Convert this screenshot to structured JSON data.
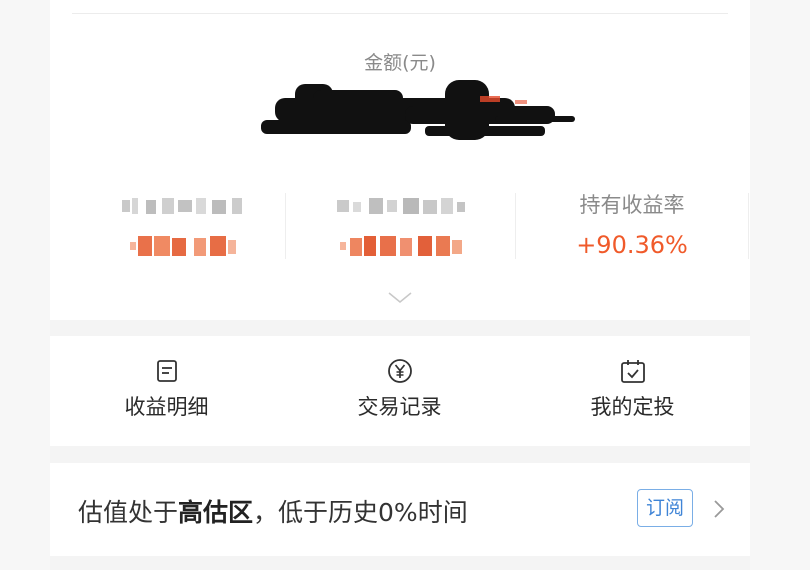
{
  "summary": {
    "amount_label": "金额(元)",
    "amount_value_redacted": true,
    "stats": [
      {
        "label_pixelated": true,
        "value_pixelated": true
      },
      {
        "label_pixelated": true,
        "value_pixelated": true
      },
      {
        "label": "持有收益率",
        "value": "+90.36%"
      }
    ],
    "expand_icon": "chevron-down-icon"
  },
  "actions": [
    {
      "label": "收益明细",
      "icon": "document-lines-icon"
    },
    {
      "label": "交易记录",
      "icon": "yen-circle-icon"
    },
    {
      "label": "我的定投",
      "icon": "calendar-check-icon"
    }
  ],
  "valuation": {
    "prefix": "估值处于",
    "zone": "高估区",
    "suffix": "，低于历史0%时间",
    "subscribe_label": "订阅",
    "arrow_icon": "chevron-right-icon"
  },
  "colors": {
    "gain": "#f05a2a",
    "link": "#3f84d6",
    "muted": "#8a8a8a"
  }
}
